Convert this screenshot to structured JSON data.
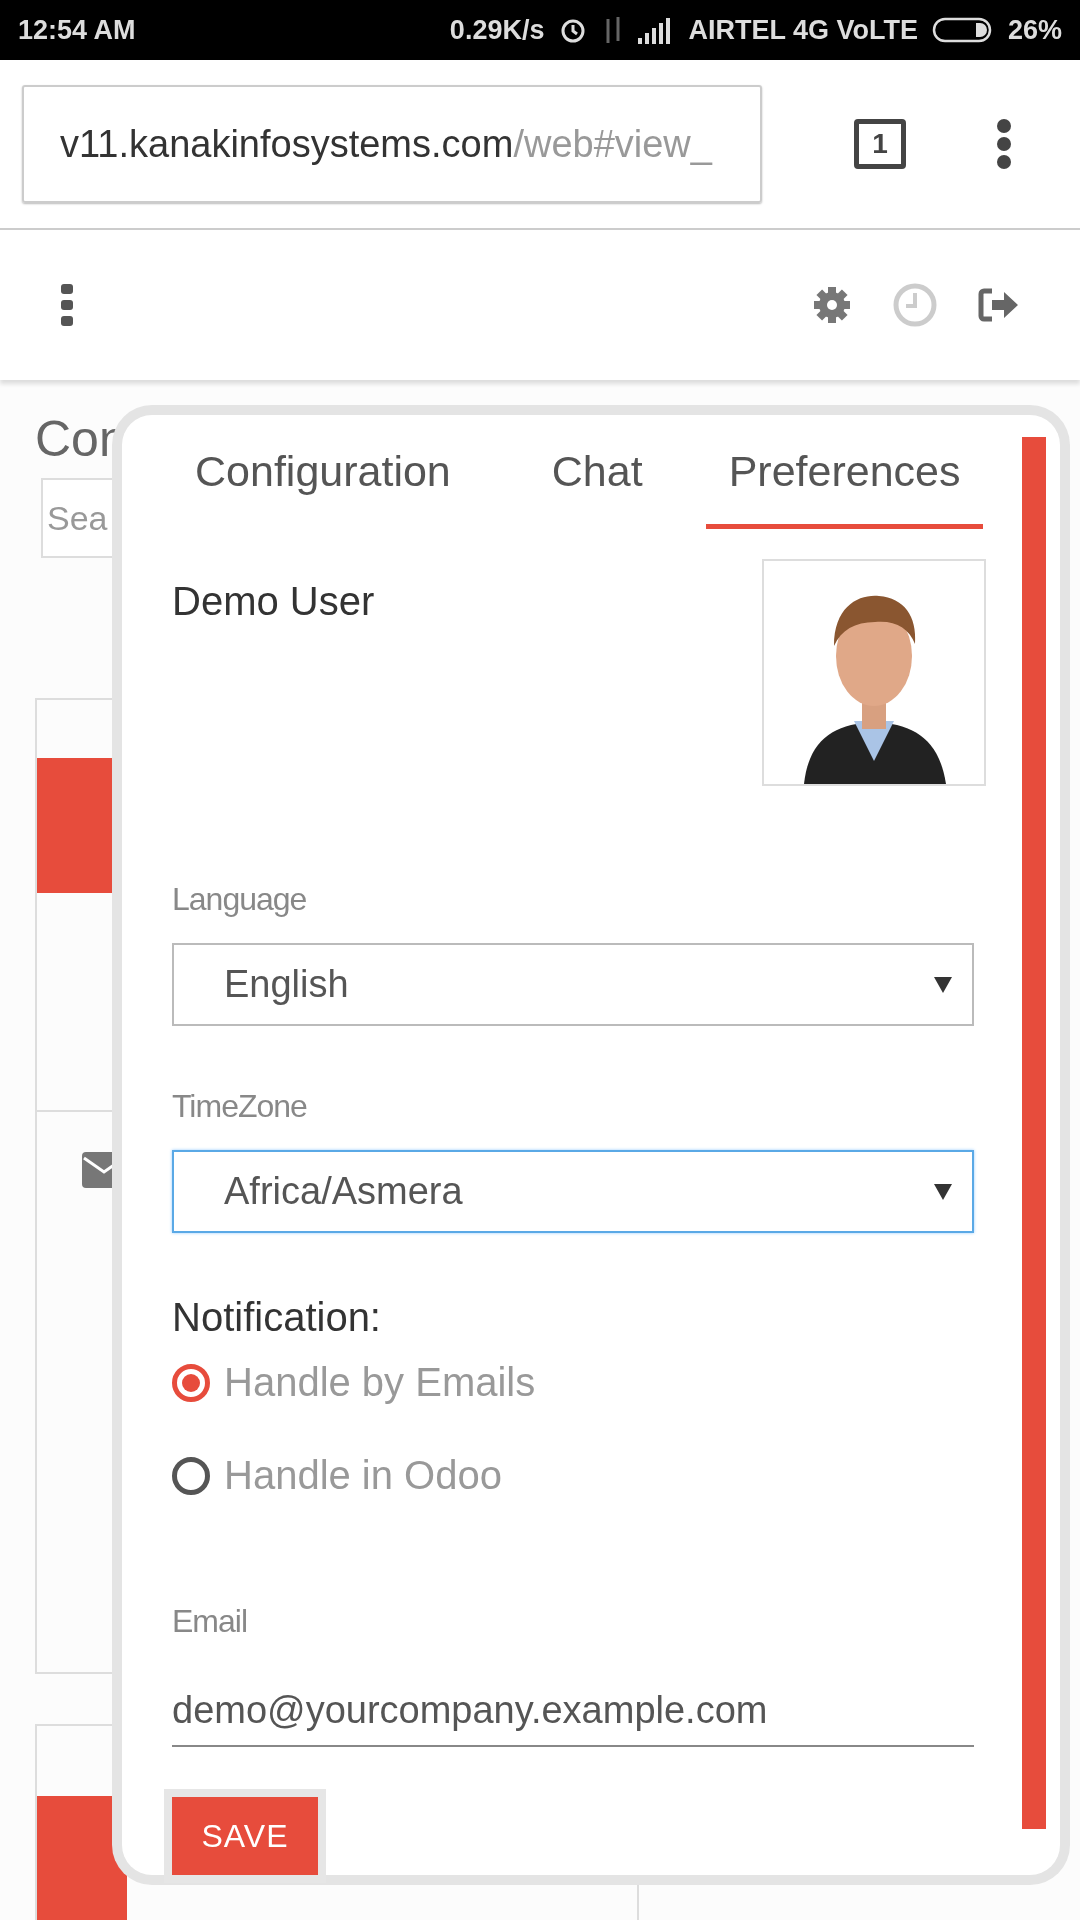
{
  "status_bar": {
    "time": "12:54 AM",
    "speed": "0.29K/s",
    "carrier": "AIRTEL 4G VoLTE",
    "battery": "26%"
  },
  "browser": {
    "url_host": "v11.kanakinfosystems.com",
    "url_path": "/web#view_",
    "tab_count": "1"
  },
  "background": {
    "title": "Con",
    "search_placeholder": "Sea"
  },
  "dialog": {
    "tabs": [
      {
        "label": "Configuration",
        "selected": false
      },
      {
        "label": "Chat",
        "selected": false
      },
      {
        "label": "Preferences",
        "selected": true
      }
    ],
    "user_name": "Demo User",
    "fields": [
      {
        "label": "Language",
        "value": "English",
        "focused": false
      },
      {
        "label": "TimeZone",
        "value": "Africa/Asmera",
        "focused": true
      }
    ],
    "notification": {
      "label": "Notification:",
      "options": [
        {
          "label": "Handle by Emails",
          "selected": true
        },
        {
          "label": "Handle in Odoo",
          "selected": false
        }
      ]
    },
    "email": {
      "label": "Email",
      "value": "demo@yourcompany.example.com"
    },
    "save": "SAVE"
  }
}
